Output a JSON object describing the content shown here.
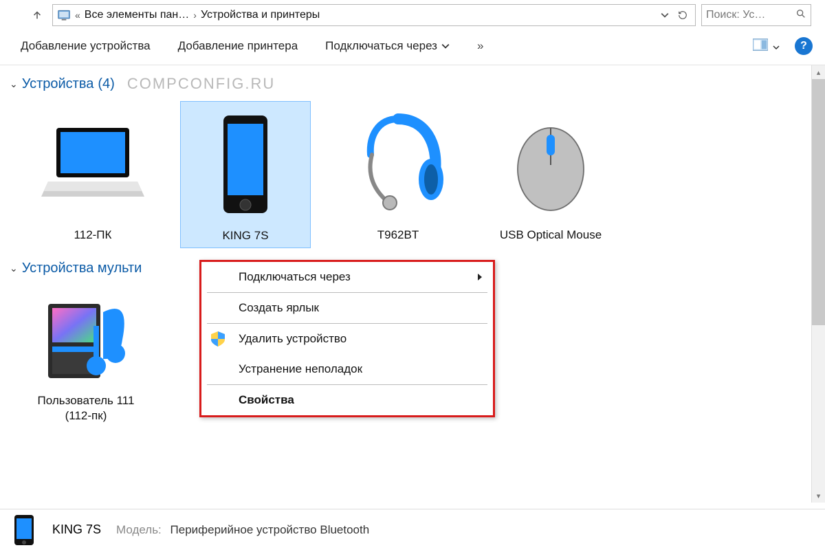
{
  "address": {
    "crumb1": "Все элементы пан…",
    "crumb2": "Устройства и принтеры"
  },
  "search": {
    "placeholder": "Поиск: Ус…"
  },
  "toolbar": {
    "add_device": "Добавление устройства",
    "add_printer": "Добавление принтера",
    "connect_via": "Подключаться через",
    "overflow": "»"
  },
  "watermark": "COMPCONFIG.RU",
  "groups": {
    "devices": {
      "title": "Устройства",
      "count": "(4)"
    },
    "multimedia": {
      "title_truncated": "Устройства мульти"
    }
  },
  "devices": [
    {
      "id": "pc",
      "label": "112-ПК"
    },
    {
      "id": "phone",
      "label": "KING 7S"
    },
    {
      "id": "bt",
      "label": "T962BT"
    },
    {
      "id": "mouse",
      "label": "USB Optical Mouse"
    }
  ],
  "multimedia": [
    {
      "id": "user",
      "label": "Пользователь 111 (112-пк)"
    }
  ],
  "context_menu": {
    "connect_via": "Подключаться через",
    "create_shortcut": "Создать ярлык",
    "remove_device": "Удалить устройство",
    "troubleshoot": "Устранение неполадок",
    "properties": "Свойства"
  },
  "details": {
    "name": "KING 7S",
    "model_label": "Модель:",
    "model_value": "Периферийное устройство Bluetooth"
  }
}
